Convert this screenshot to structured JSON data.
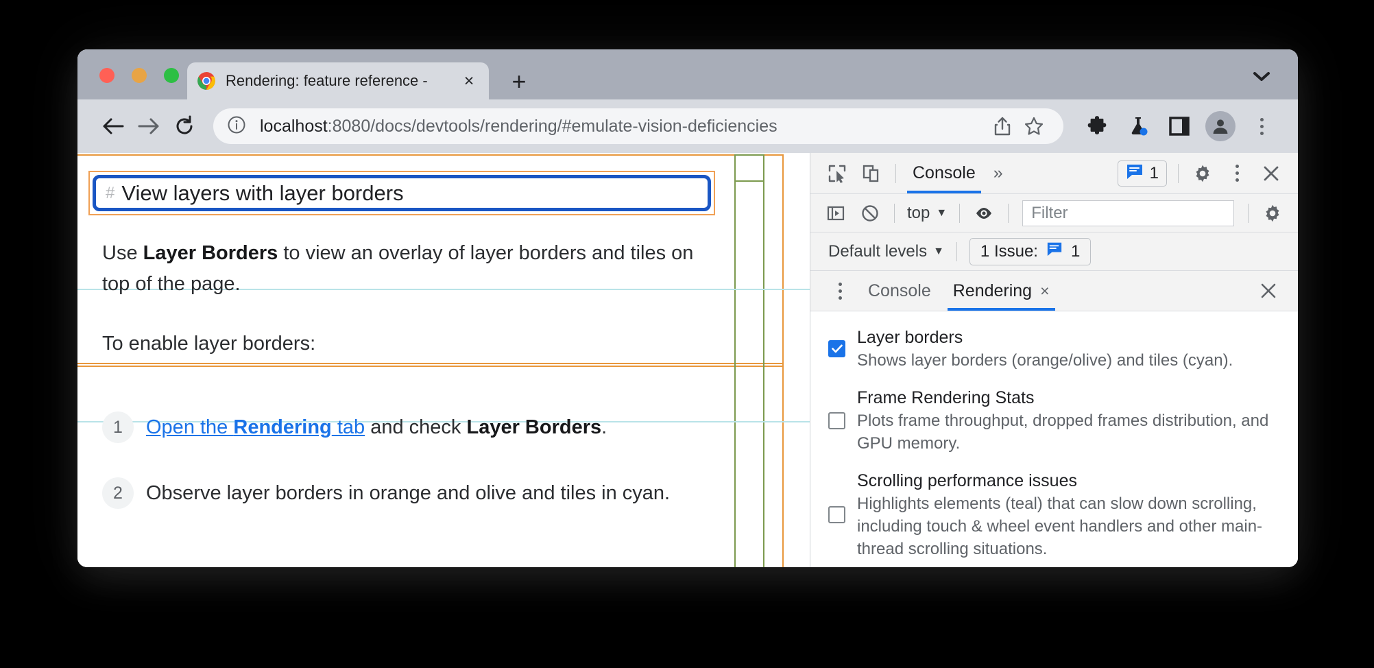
{
  "window": {
    "traffic_lights": [
      {
        "name": "close",
        "color": "#ff6055"
      },
      {
        "name": "minimize",
        "color": "#e8a445"
      },
      {
        "name": "maximize",
        "color": "#2dbf44"
      }
    ],
    "tab": {
      "title": "Rendering: feature reference - ",
      "close_label": "×",
      "favicon": "chrome-logo-icon"
    },
    "new_tab_label": "+",
    "tab_list_chevron": "chevron-down-icon"
  },
  "toolbar": {
    "back": "←",
    "forward": "→",
    "reload": "↻",
    "site_info_icon": "info-circle-icon",
    "url_host": "localhost",
    "url_rest": ":8080/docs/devtools/rendering/#emulate-vision-deficiencies",
    "share_icon": "share-icon",
    "bookmark_icon": "star-icon",
    "extensions_icon": "puzzle-icon",
    "experiments_icon": "flask-icon",
    "sidepanel_icon": "side-panel-icon",
    "profile_icon": "avatar-icon",
    "menu_icon": "three-dot-menu-icon"
  },
  "page": {
    "heading": "View layers with layer borders",
    "anchor_hash": "#",
    "paragraph_1": {
      "before": "Use ",
      "bold": "Layer Borders",
      "after": " to view an overlay of layer borders and tiles on top of the page."
    },
    "paragraph_2": "To enable layer borders:",
    "steps": [
      {
        "num": "1",
        "link_pre": "Open the ",
        "link_bold": "Rendering",
        "link_post": " tab",
        "mid": " and check ",
        "bold": "Layer Borders",
        "end": "."
      },
      {
        "num": "2",
        "text": "Observe layer borders in orange and olive and tiles in cyan."
      }
    ],
    "layer_border_colors": {
      "orange": "#e8973c",
      "olive": "#7c9a4e",
      "tile_cyan": "#b9e3e8",
      "heading_layer": "#1a56c4"
    }
  },
  "devtools": {
    "main_toolbar": {
      "inspect_icon": "inspect-cursor-icon",
      "device_toolbar_icon": "device-toggle-icon",
      "active_panel": "Console",
      "more_panels": "»",
      "issues_count": "1",
      "issues_icon": "issue-message-icon",
      "settings_icon": "gear-icon",
      "more_icon": "three-dot-menu-icon",
      "close_icon": "close-icon"
    },
    "console_toolbar": {
      "sidebar_icon": "console-sidebar-icon",
      "clear_icon": "clear-console-icon",
      "context": "top",
      "context_caret": "▼",
      "eye_icon": "live-expression-icon",
      "filter_placeholder": "Filter",
      "settings_icon": "gear-icon"
    },
    "levels_row": {
      "levels_label": "Default levels",
      "levels_caret": "▼",
      "issues_label": "1 Issue:",
      "issues_icon": "issue-message-icon",
      "issues_count": "1"
    },
    "drawer_tabs": {
      "menu_icon": "three-dot-menu-icon",
      "tabs": [
        {
          "label": "Console",
          "active": false,
          "closable": false
        },
        {
          "label": "Rendering",
          "active": true,
          "closable": true,
          "close_label": "×"
        }
      ],
      "close_drawer_icon": "close-icon",
      "close_drawer_label": "×"
    },
    "rendering_options": [
      {
        "title": "Layer borders",
        "description": "Shows layer borders (orange/olive) and tiles (cyan).",
        "checked": true
      },
      {
        "title": "Frame Rendering Stats",
        "description": "Plots frame throughput, dropped frames distribution, and GPU memory.",
        "checked": false
      },
      {
        "title": "Scrolling performance issues",
        "description": "Highlights elements (teal) that can slow down scrolling, including touch & wheel event handlers and other main-thread scrolling situations.",
        "checked": false
      }
    ]
  }
}
